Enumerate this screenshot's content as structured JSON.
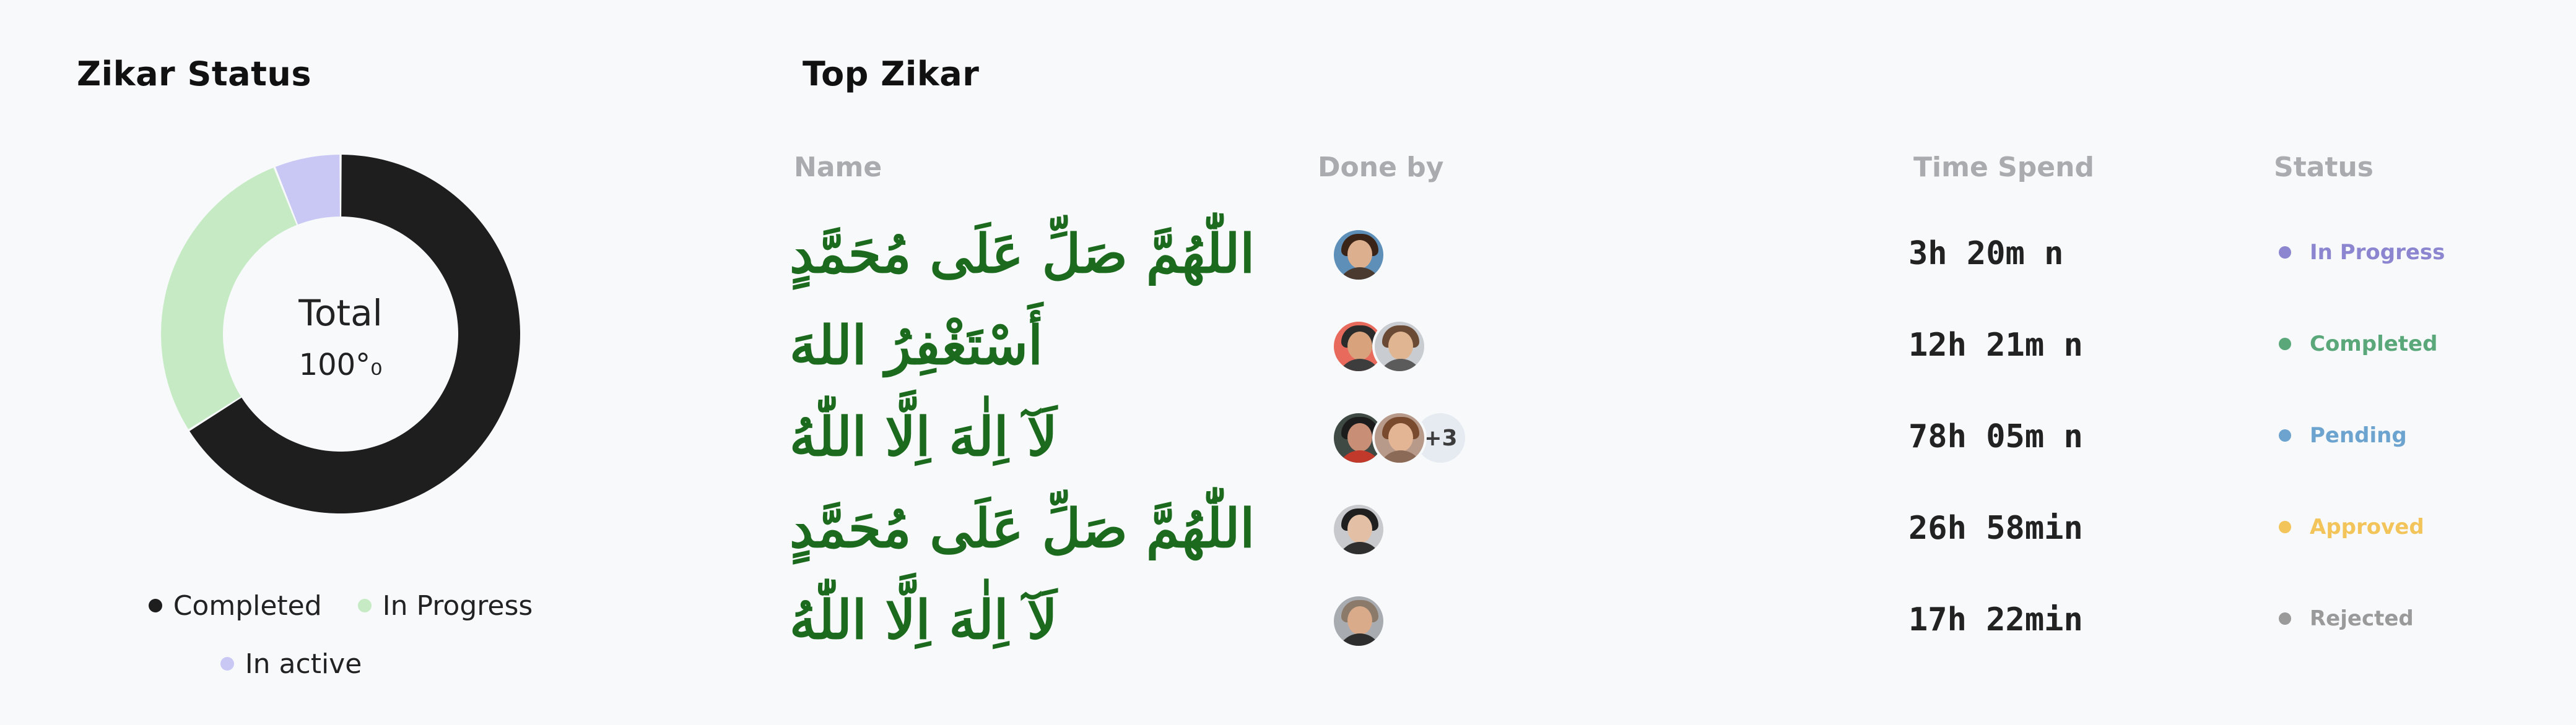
{
  "status_panel": {
    "title": "Zikar Status",
    "center_label": "Total",
    "center_value": "100°₀",
    "legend": [
      {
        "label": "Completed",
        "color": "#1e1e1e"
      },
      {
        "label": "In Progress",
        "color": "#c6ebc4"
      },
      {
        "label": "In active",
        "color": "#c9c8f5"
      }
    ]
  },
  "chart_data": {
    "type": "pie",
    "title": "Zikar Status",
    "categories": [
      "Completed",
      "In Progress",
      "In active"
    ],
    "values": [
      66,
      28,
      6
    ],
    "colors": [
      "#1e1e1e",
      "#c6ebc4",
      "#c9c8f5"
    ]
  },
  "top_panel": {
    "title": "Top Zikar",
    "columns": {
      "name": "Name",
      "done_by": "Done by",
      "time": "Time Spend",
      "status": "Status"
    },
    "rows": [
      {
        "name": "اللّٰهُمَّ صَلِّ عَلَى مُحَمَّدٍ",
        "avatars": [
          "avatar-woman-curly",
          null
        ],
        "more": "",
        "time": "3h 20m n",
        "status": "In Progress",
        "status_color": "#8b86cf"
      },
      {
        "name": "أَسْتَغْفِرُ اللهَ",
        "avatars": [
          "avatar-man-red-bg",
          "avatar-man-grey-bg"
        ],
        "more": "",
        "time": "12h 21m n",
        "status": "Completed",
        "status_color": "#5aa87a"
      },
      {
        "name": "لَآ اِلٰهَ اِلَّا اللّٰهُ",
        "avatars": [
          "avatar-man-dark",
          "avatar-woman-brown"
        ],
        "more": "+3",
        "time": "78h 05m n",
        "status": "Pending",
        "status_color": "#6ca3cf"
      },
      {
        "name": "اللّٰهُمَّ صَلِّ عَلَى مُحَمَّدٍ",
        "avatars": [
          "avatar-woman-dark-hair"
        ],
        "more": "",
        "time": "26h 58min",
        "status": "Approved",
        "status_color": "#f2c45a"
      },
      {
        "name": "لَآ اِلٰهَ اِلَّا اللّٰهُ",
        "avatars": [
          "avatar-man-cap"
        ],
        "more": "",
        "time": "17h 22min",
        "status": "Rejected",
        "status_color": "#9a9a9a"
      }
    ]
  }
}
